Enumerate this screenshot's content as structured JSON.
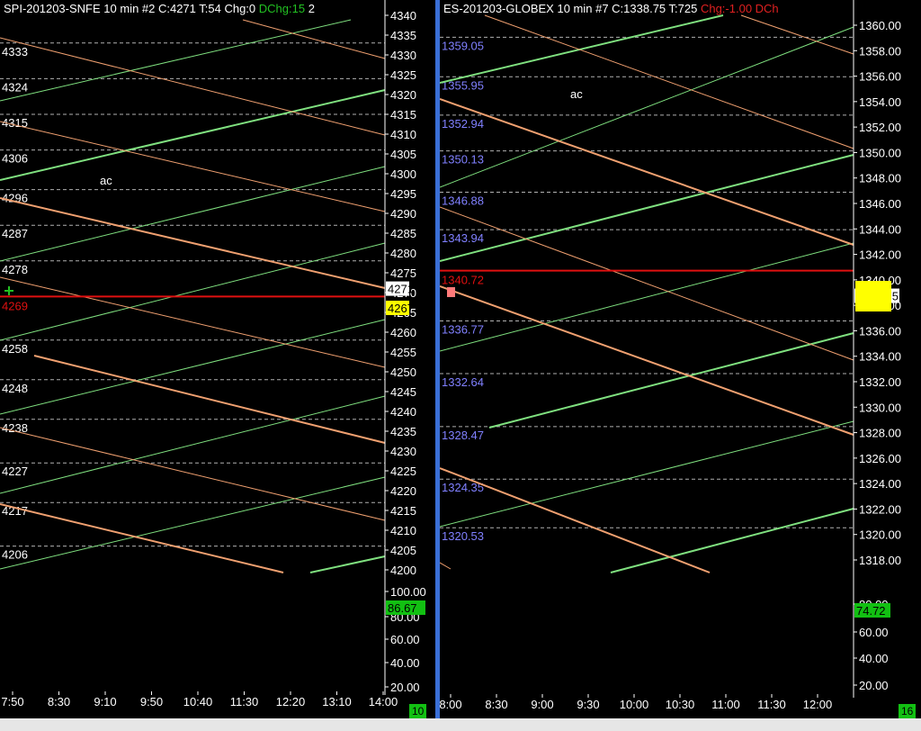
{
  "left_pane": {
    "header_symbol": "SPI-201203-SNFE  10 min  #2 C:4271 T:54 Chg:0",
    "header_dchg": " DChg:15",
    "header_tail": " 2",
    "overlay_text": "ac",
    "last_price_label": "4271",
    "marker_price_label": "4267",
    "red_line_label": "4269",
    "volume_badge": "86.67",
    "corner_badge": "10"
  },
  "right_pane": {
    "header_symbol": "ES-201203-GLOBEX  10 min  #7 C:1338.75 T:725",
    "header_chg": " Chg:-1.00 DCh",
    "overlay_text": "ac",
    "last_price_label": "1338.75",
    "red_line_label": "1340.72",
    "volume_badge": "74.72",
    "corner_badge": "16"
  },
  "colors": {
    "background": "#000000",
    "axis_text": "#ffffff",
    "grid_dashed": "#d0d0d0",
    "level_label_right": "#8080ff",
    "green_line": "#7fe07f",
    "orange_line": "#f0a070",
    "red_line": "#e01010",
    "divider": "#3a6fd6"
  },
  "chart_data": [
    {
      "type": "line",
      "name": "SPI-201203-SNFE",
      "x_ticks": [
        "7:50",
        "8:30",
        "9:10",
        "9:50",
        "10:40",
        "11:30",
        "12:20",
        "13:10",
        "14:00"
      ],
      "y_ticks": [
        "4340",
        "4335",
        "4330",
        "4325",
        "4320",
        "4315",
        "4310",
        "4305",
        "4300",
        "4295",
        "4290",
        "4285",
        "4280",
        "4275",
        "4270",
        "4265",
        "4260",
        "4255",
        "4250",
        "4245",
        "4240",
        "4235",
        "4230",
        "4225",
        "4220",
        "4215",
        "4210",
        "4205",
        "4200"
      ],
      "ylim": [
        4200,
        4340
      ],
      "level_labels": [
        "4333",
        "4324",
        "4315",
        "4306",
        "4296",
        "4287",
        "4278",
        "4258",
        "4248",
        "4238",
        "4227",
        "4217",
        "4206"
      ],
      "red_level": 4269,
      "last_price": 4271,
      "volume_axis_ticks": [
        "100.00",
        "60.00",
        "40.00",
        "20.00"
      ],
      "volume_axis_marker": "80.00",
      "volume_last": 86.67
    },
    {
      "type": "line",
      "name": "ES-201203-GLOBEX",
      "x_ticks": [
        "8:00",
        "8:30",
        "9:00",
        "9:30",
        "10:00",
        "10:30",
        "11:00",
        "11:30",
        "12:00"
      ],
      "y_ticks": [
        "1360.00",
        "1358.00",
        "1356.00",
        "1354.00",
        "1352.00",
        "1350.00",
        "1348.00",
        "1346.00",
        "1344.00",
        "1342.00",
        "1340.00",
        "1338.00",
        "1336.00",
        "1334.00",
        "1332.00",
        "1330.00",
        "1328.00",
        "1326.00",
        "1324.00",
        "1322.00",
        "1320.00",
        "1318.00"
      ],
      "ylim": [
        1318,
        1360
      ],
      "level_labels": [
        "1359.05",
        "1355.95",
        "1352.94",
        "1350.13",
        "1346.88",
        "1343.94",
        "1336.77",
        "1332.64",
        "1328.47",
        "1324.35",
        "1320.53"
      ],
      "red_level": 1340.72,
      "last_price": 1338.75,
      "volume_axis_ticks": [
        "80.00",
        "60.00",
        "40.00",
        "20.00"
      ],
      "volume_last": 74.72
    }
  ]
}
